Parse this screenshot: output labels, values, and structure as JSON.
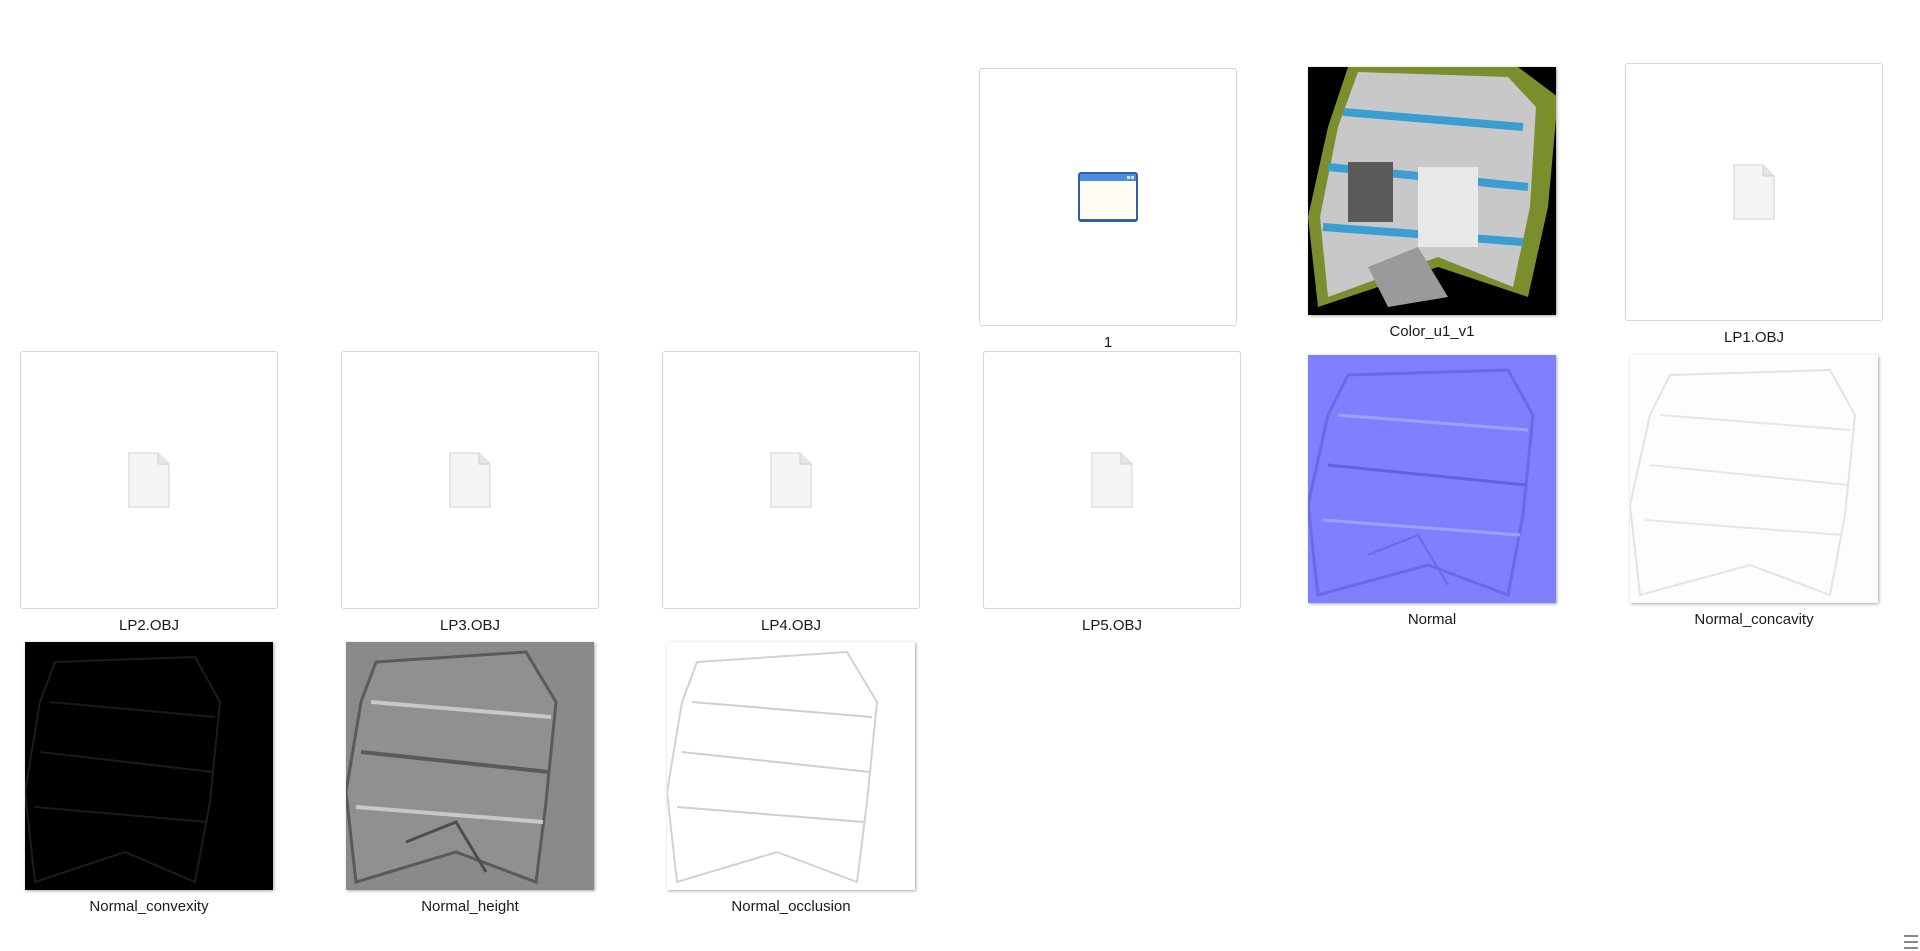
{
  "files": [
    {
      "name": "1",
      "kind": "application"
    },
    {
      "name": "Color_u1_v1",
      "kind": "image",
      "preview": "color-texture"
    },
    {
      "name": "LP1.OBJ",
      "kind": "document"
    },
    {
      "name": "LP2.OBJ",
      "kind": "document"
    },
    {
      "name": "LP3.OBJ",
      "kind": "document"
    },
    {
      "name": "LP4.OBJ",
      "kind": "document"
    },
    {
      "name": "LP5.OBJ",
      "kind": "document"
    },
    {
      "name": "Normal",
      "kind": "image",
      "preview": "normal-map"
    },
    {
      "name": "Normal_concavity",
      "kind": "image",
      "preview": "concavity-map"
    },
    {
      "name": "Normal_convexity",
      "kind": "image",
      "preview": "convexity-map"
    },
    {
      "name": "Normal_height",
      "kind": "image",
      "preview": "height-map"
    },
    {
      "name": "Normal_occlusion",
      "kind": "image",
      "preview": "occlusion-map"
    }
  ],
  "icons": {
    "document": "blank-document-icon",
    "application": "application-window-icon",
    "view_toggle": "view-options-icon"
  },
  "colors": {
    "normal_map": "#8080ff",
    "texture_blue_stripe": "#3a9fd0",
    "texture_grass": "#7a8a2a",
    "background": "#ffffff"
  }
}
